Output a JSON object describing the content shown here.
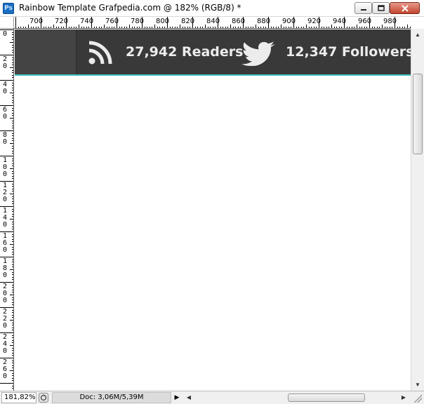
{
  "window": {
    "app_icon_label": "Ps",
    "title": "Rainbow Template Grafpedia.com @ 182% (RGB/8) *"
  },
  "rulers": {
    "top_labels": [
      "700",
      "720",
      "740",
      "760",
      "780",
      "800",
      "820",
      "840",
      "860",
      "880",
      "900",
      "920",
      "940",
      "960",
      "980"
    ],
    "left_labels": [
      "0",
      "20",
      "40",
      "60",
      "80",
      "100",
      "120",
      "140",
      "160",
      "180",
      "200",
      "220",
      "240",
      "260"
    ]
  },
  "canvas": {
    "readers_text": "27,942 Readers",
    "followers_text": "12,347 Followers",
    "colors": {
      "bar": "#3a3939",
      "accent_line": "#3ec2c0",
      "text": "#ececec"
    }
  },
  "statusbar": {
    "zoom": "181,82%",
    "doc_info": "Doc: 3,06M/5,39M"
  },
  "icons": [
    "photoshop-icon",
    "minimize-icon",
    "maximize-icon",
    "close-icon",
    "rss-icon",
    "twitter-bird-icon",
    "arrow-up-icon",
    "arrow-down-icon",
    "arrow-left-icon",
    "arrow-right-icon"
  ]
}
